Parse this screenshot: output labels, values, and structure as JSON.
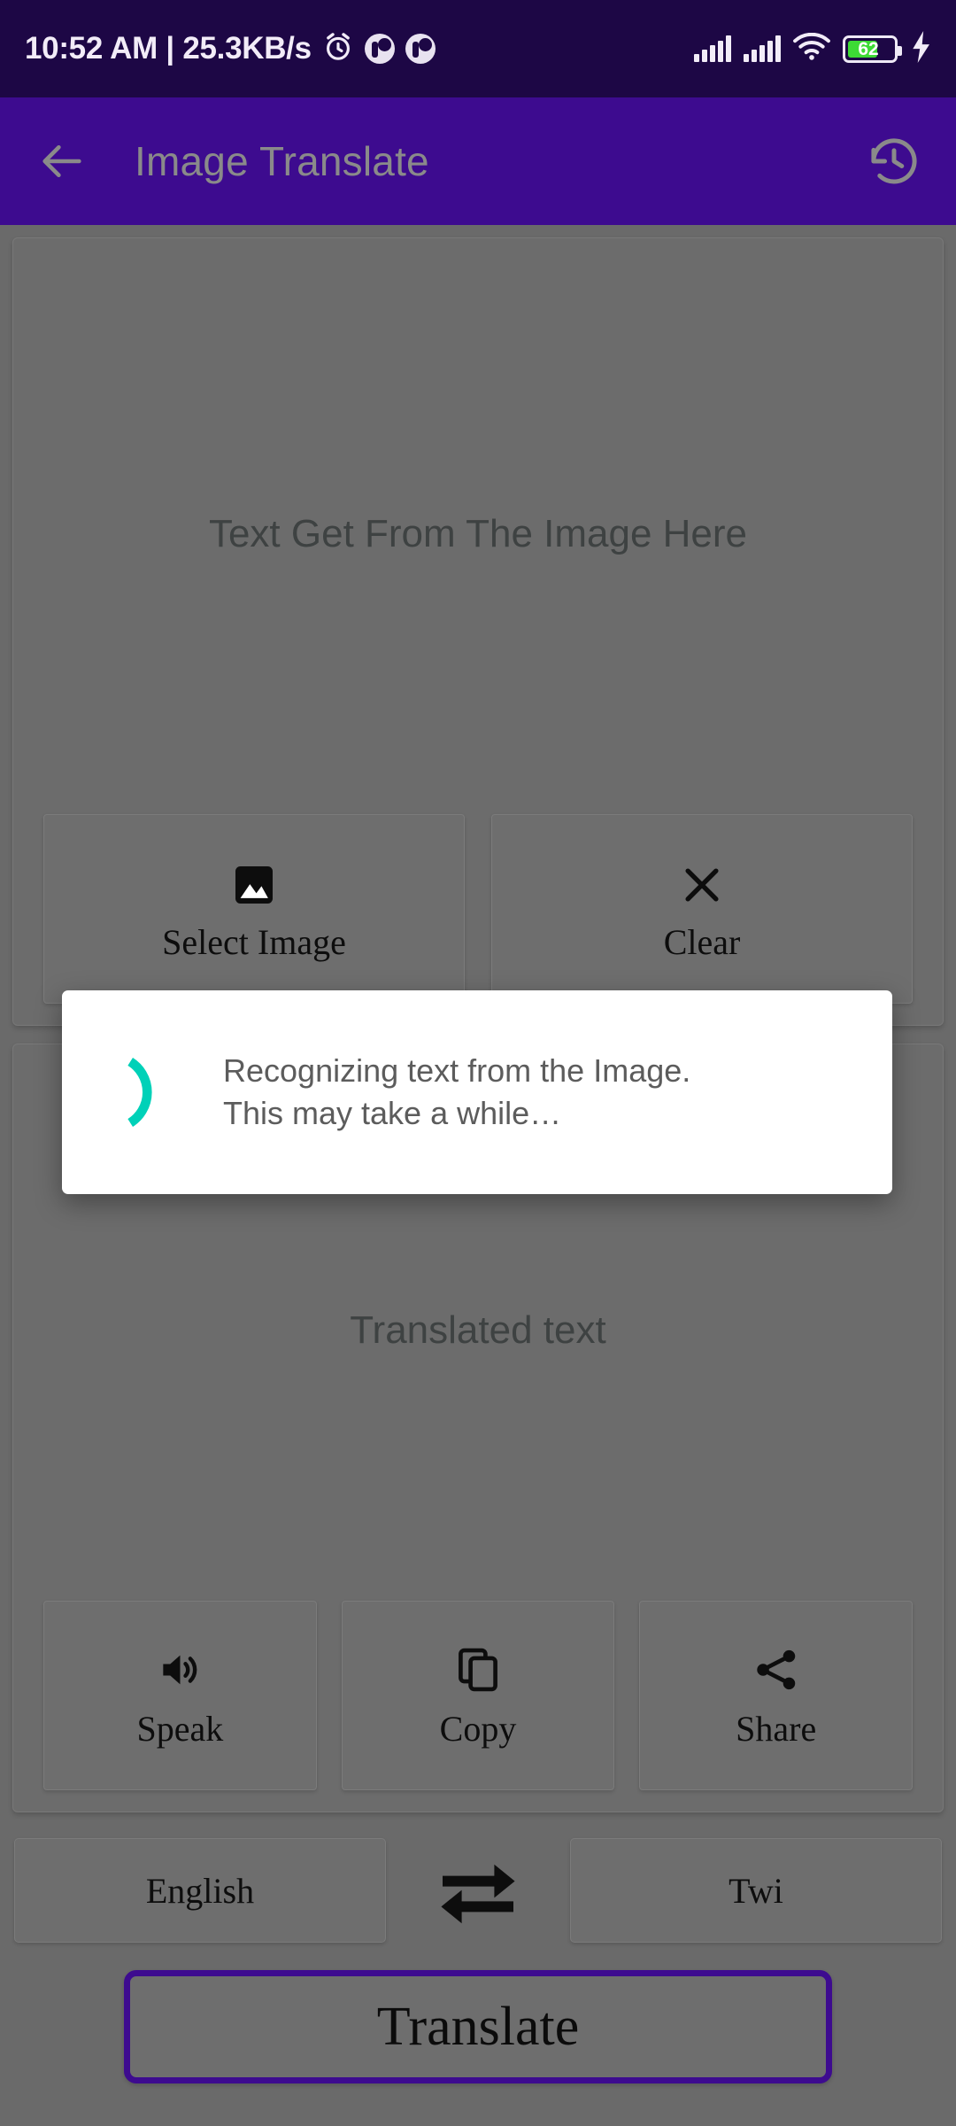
{
  "status_bar": {
    "clock": "10:52 AM | 25.3KB/s",
    "icons": [
      "alarm-clock-icon",
      "notification-app-icon",
      "notification-app-icon"
    ],
    "signal_1": "signal-bars-icon",
    "signal_2": "signal-bars-icon",
    "wifi": "wifi-icon",
    "battery_percent": "62",
    "charging": "charging-bolt-icon",
    "background_color": "#1d0745"
  },
  "app_bar": {
    "back_label": "back-arrow-icon",
    "title": "Image Translate",
    "history_label": "history-icon",
    "background_color": "#3d0b8f",
    "title_color": "#8a8a8a"
  },
  "source_card": {
    "placeholder": "Text Get From The Image Here",
    "buttons": [
      {
        "label": "Select Image",
        "icon": "image-icon"
      },
      {
        "label": "Clear",
        "icon": "close-x-icon"
      }
    ]
  },
  "target_card": {
    "placeholder": "Translated text",
    "buttons": [
      {
        "label": "Speak",
        "icon": "volume-up-icon"
      },
      {
        "label": "Copy",
        "icon": "copy-icon"
      },
      {
        "label": "Share",
        "icon": "share-icon"
      }
    ]
  },
  "language_row": {
    "source_language": "English",
    "swap_icon": "swap-horizontal-arrows-icon",
    "target_language": "Twi"
  },
  "translate_button": {
    "label": "Translate",
    "border_color": "#3d0b8f"
  },
  "dialog": {
    "message": "Recognizing text from the Image.\nThis may take a while…",
    "spinner": "loading-spinner-arc",
    "spinner_color": "#00d1b8",
    "background_color": "#ffffff"
  },
  "theme": {
    "scrim_background": "#6a6a6a",
    "card_background": "#6c6c6c",
    "accent_purple": "#3d0b8f"
  }
}
